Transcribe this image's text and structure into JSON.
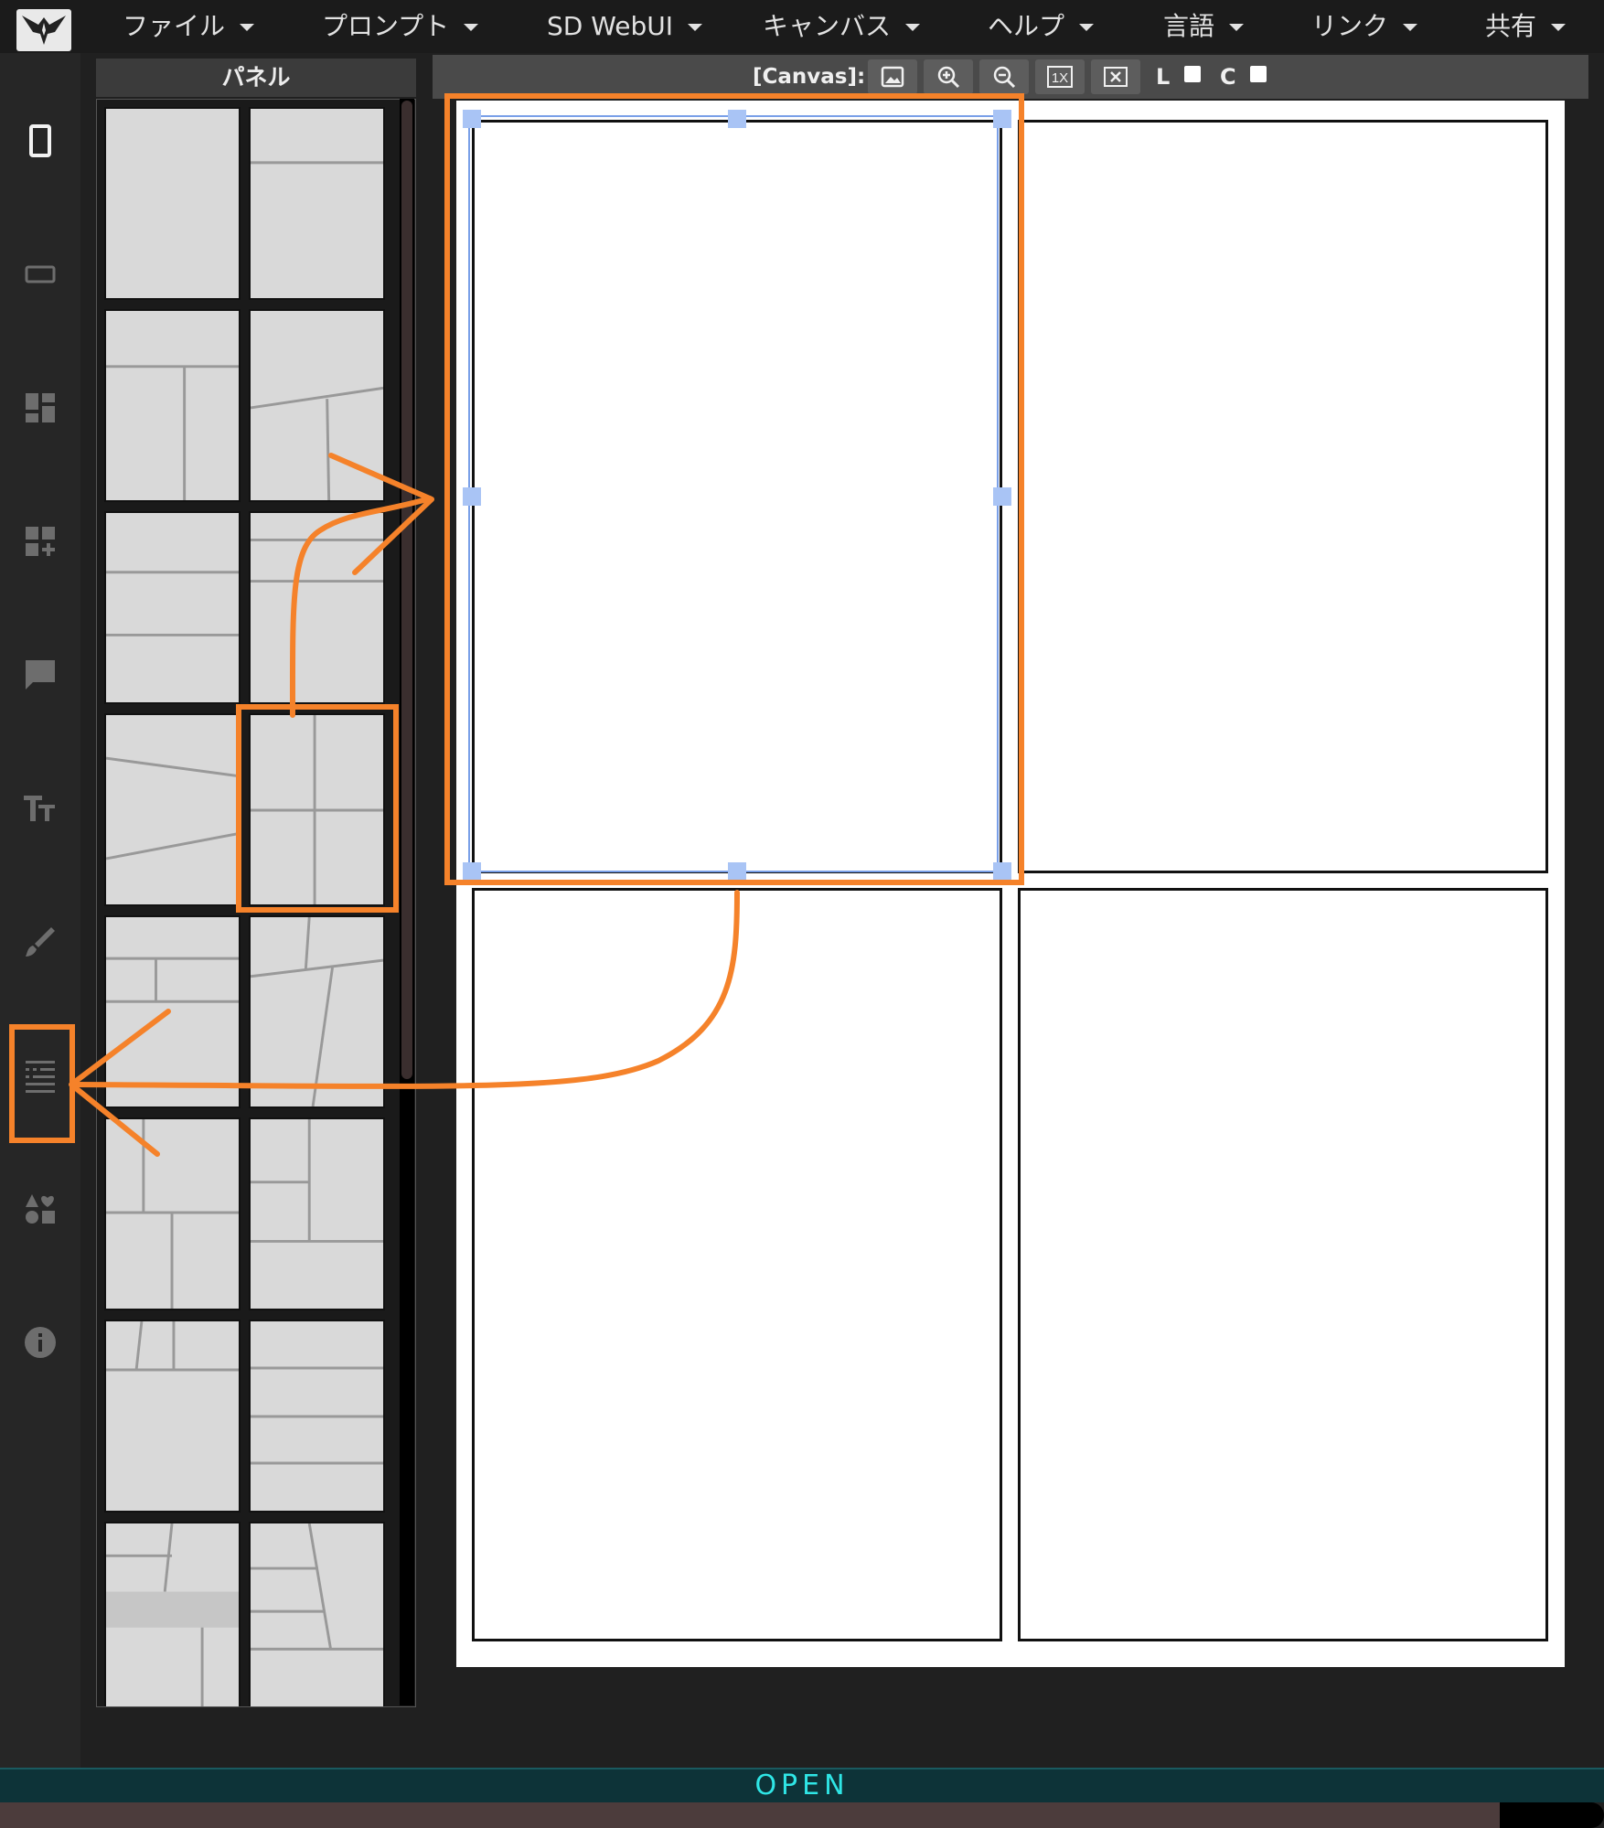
{
  "menu": {
    "items": [
      {
        "label": "ファイル"
      },
      {
        "label": "プロンプト"
      },
      {
        "label": "SD WebUI"
      },
      {
        "label": "キャンバス"
      },
      {
        "label": "ヘルプ"
      },
      {
        "label": "言語"
      },
      {
        "label": "リンク"
      },
      {
        "label": "共有"
      }
    ]
  },
  "rail": {
    "icons": [
      "portrait-page-icon",
      "landscape-page-icon",
      "dashboard-icon",
      "add-dashboard-icon",
      "speech-bubble-icon",
      "text-size-icon",
      "brush-icon",
      "list-settings-icon",
      "shapes-icon",
      "info-icon"
    ]
  },
  "panel": {
    "title": "パネル"
  },
  "toolbar": {
    "canvas_label": "[Canvas]:",
    "buttons": [
      "image-icon",
      "zoom-in-icon",
      "zoom-out-icon",
      "one-x-icon",
      "close-box-icon"
    ],
    "one_x_label": "1X",
    "l_label": "L",
    "c_label": "C"
  },
  "status": {
    "open_label": "OPEN",
    "progress": 0.935
  },
  "colors": {
    "accent_annotation": "#f5822a",
    "handle": "#a9c4f5",
    "status_text": "#2fe6e6"
  }
}
